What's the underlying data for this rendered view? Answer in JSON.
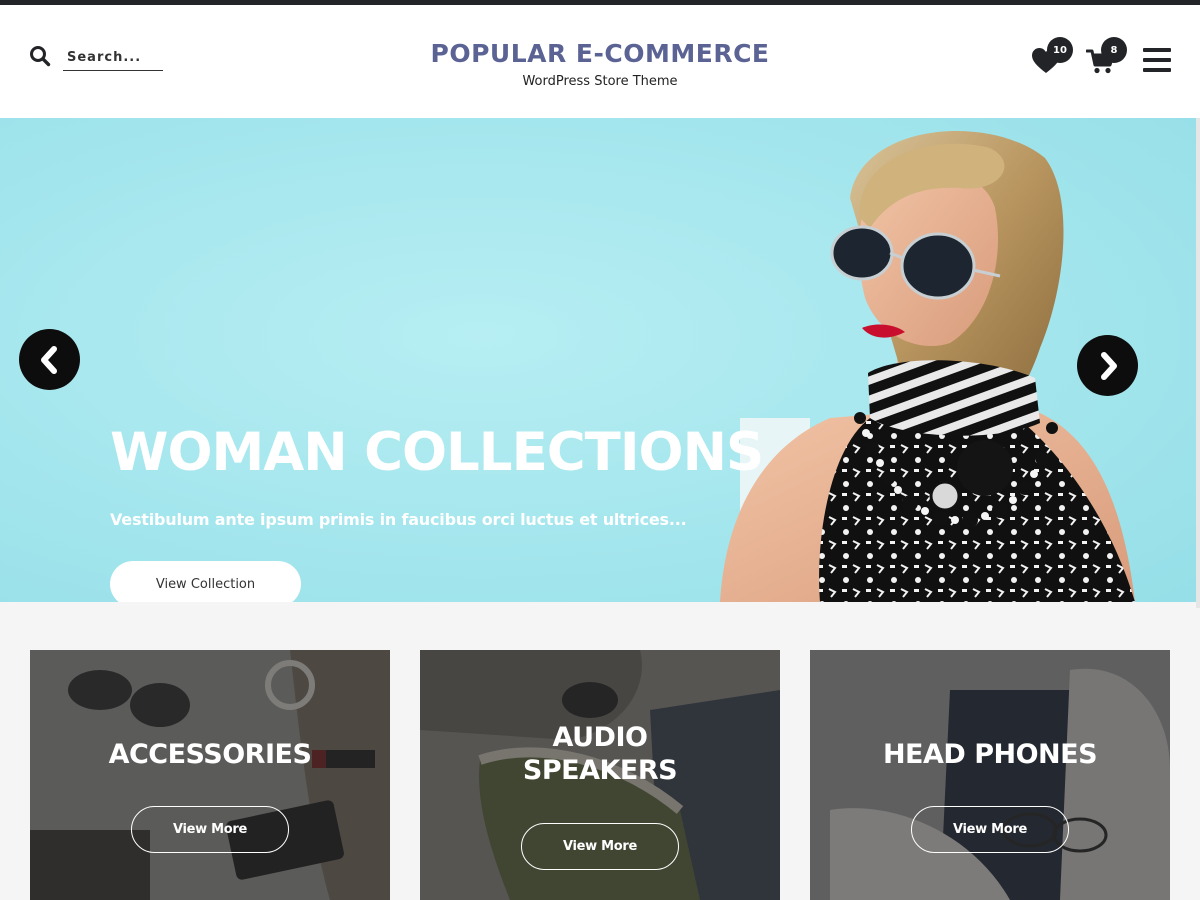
{
  "header": {
    "search_placeholder": "Search...",
    "brand_title": "POPULAR E-COMMERCE",
    "brand_tagline": "WordPress Store Theme",
    "wishlist_count": "10",
    "cart_count": "8"
  },
  "hero": {
    "heading": "WOMAN COLLECTIONS",
    "subheading": "Vestibulum ante ipsum primis in faucibus orci luctus et ultrices...",
    "button_label": "View Collection"
  },
  "categories": [
    {
      "title": "ACCESSORIES",
      "button_label": "View More"
    },
    {
      "title_line1": "AUDIO",
      "title_line2": "SPEAKERS",
      "button_label": "View More"
    },
    {
      "title": "HEAD PHONES",
      "button_label": "View More"
    }
  ],
  "colors": {
    "brand": "#5a6394",
    "dark": "#222427",
    "hero_bg": "#a7e7ee"
  },
  "icons": {
    "search": "search-icon",
    "wishlist": "heart-icon",
    "cart": "cart-icon",
    "menu": "hamburger-menu-icon",
    "prev": "chevron-left-icon",
    "next": "chevron-right-icon"
  }
}
